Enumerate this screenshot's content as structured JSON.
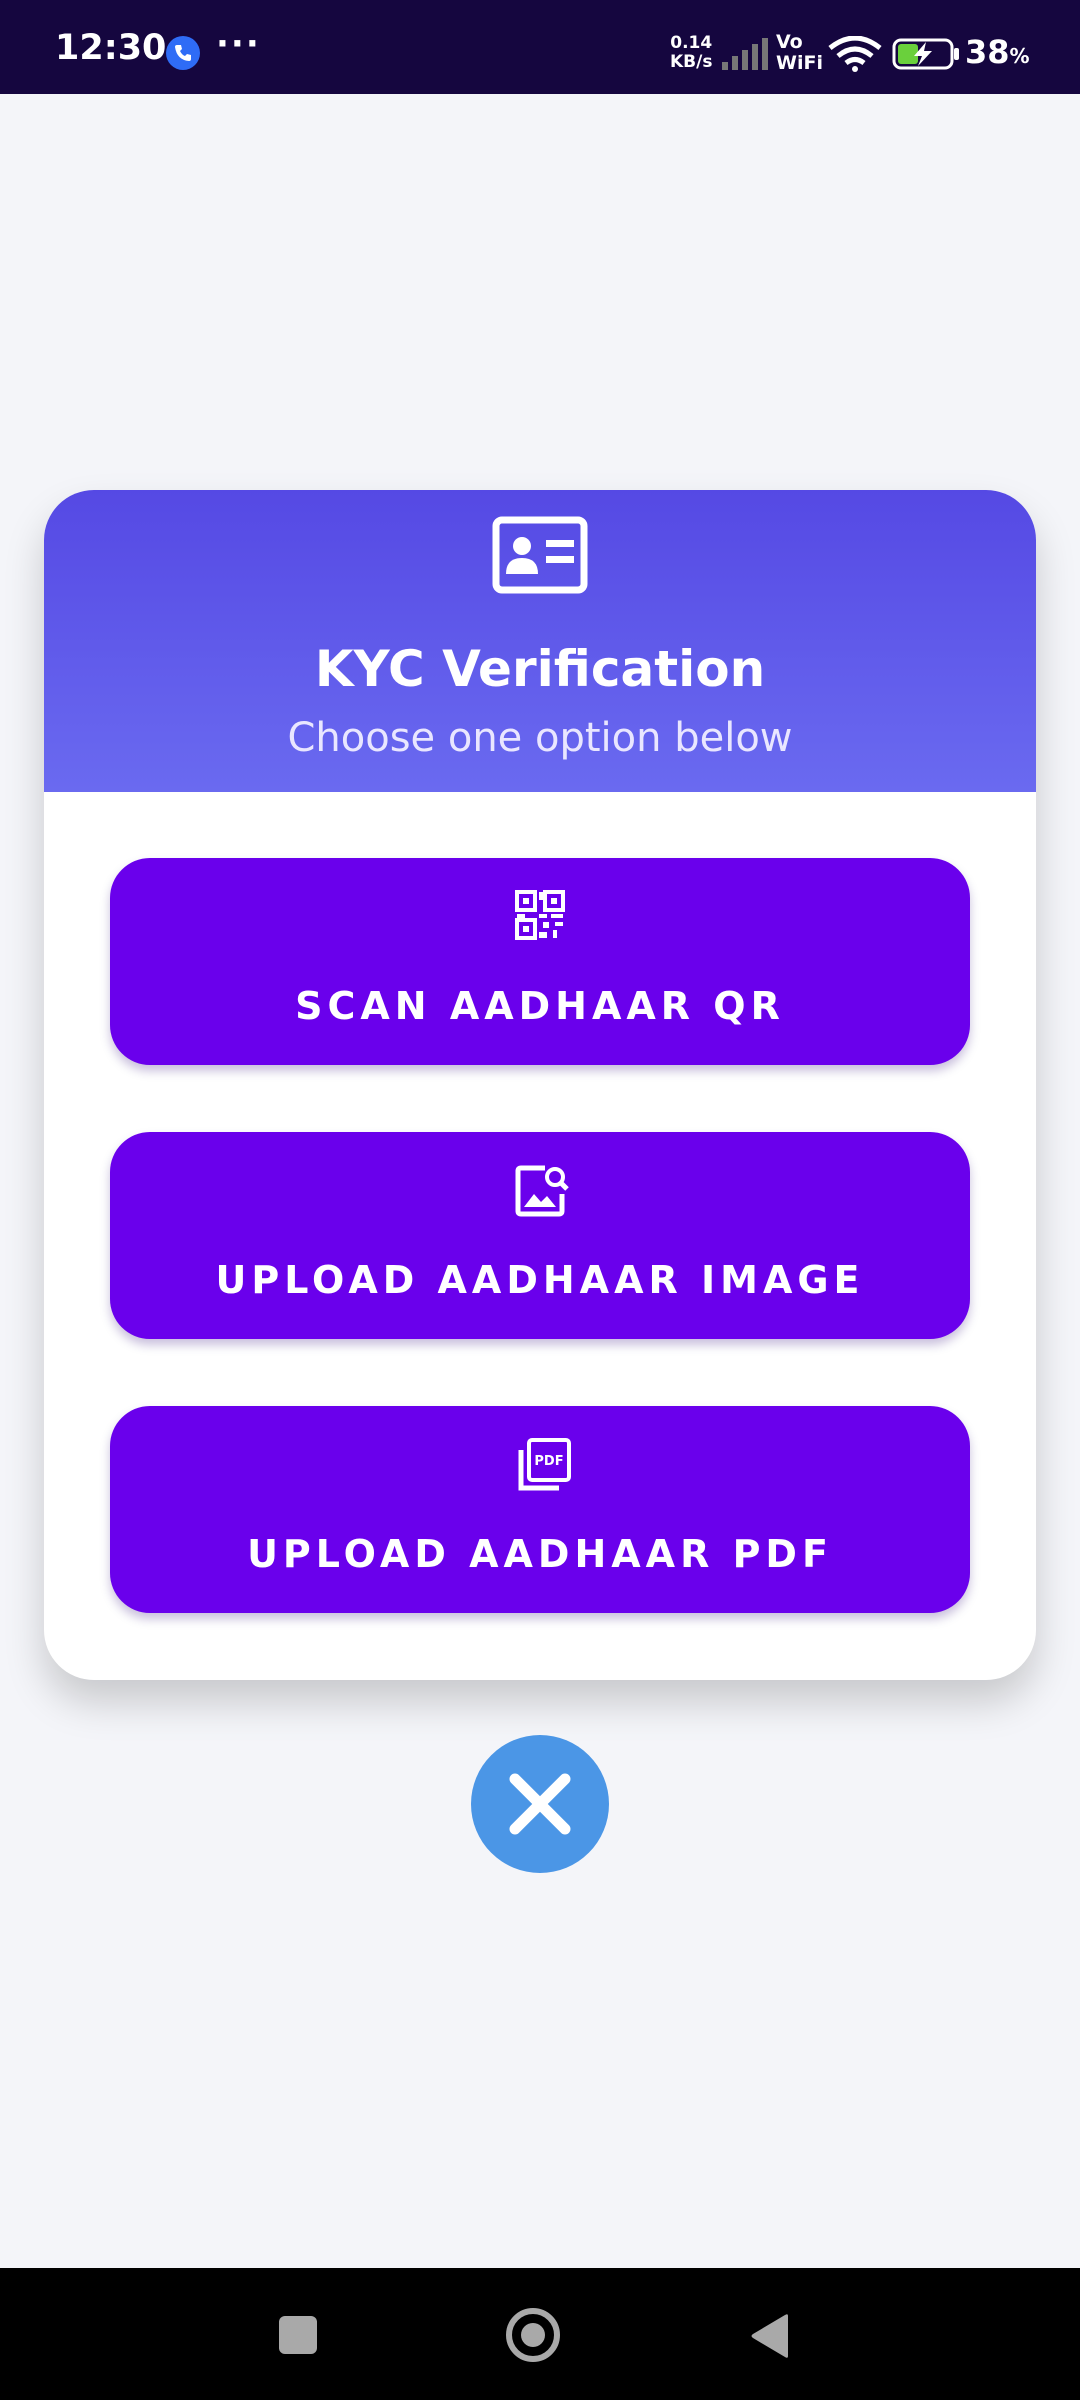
{
  "status_bar": {
    "time": "12:30",
    "dots": "···",
    "speed_value": "0.14",
    "speed_unit": "KB/s",
    "vo": "Vo",
    "wifi": "WiFi",
    "battery_percent": "38",
    "percent_sign": "%"
  },
  "dialog": {
    "header_icon": "id-card-icon",
    "title": "KYC Verification",
    "subtitle": "Choose one option below",
    "accent_color": "#6a00ec",
    "header_color": "#5549e4",
    "options": [
      {
        "icon": "qr-code-icon",
        "label": "SCAN AADHAAR QR"
      },
      {
        "icon": "image-search-icon",
        "label": "UPLOAD AADHAAR IMAGE"
      },
      {
        "icon": "pdf-file-icon",
        "label": "UPLOAD AADHAAR PDF"
      }
    ],
    "close_icon": "close-icon",
    "close_color": "#4b96e6"
  },
  "nav_bar": {
    "items": [
      "recent-apps-button",
      "home-button",
      "back-button"
    ]
  }
}
